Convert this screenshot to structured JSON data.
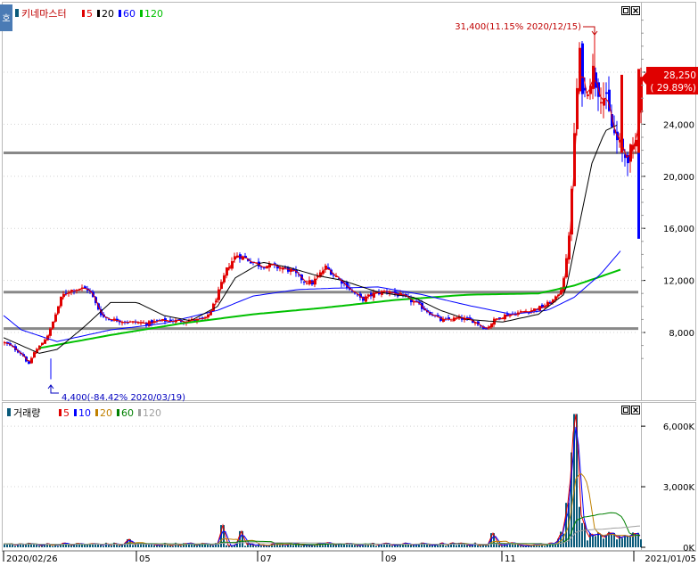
{
  "app": {
    "corner_label": "호",
    "window_buttons": [
      "□",
      "×"
    ]
  },
  "price_panel": {
    "stock_name": "키네마스터",
    "ma_legend": [
      {
        "label": "5",
        "color": "#e00000"
      },
      {
        "label": "20",
        "color": "#000000"
      },
      {
        "label": "60",
        "color": "#0000ff"
      },
      {
        "label": "120",
        "color": "#00c000"
      }
    ],
    "y_ticks": [
      "28,000",
      "24,000",
      "20,000",
      "16,000",
      "12,000",
      "8,000"
    ],
    "high_annotation": "31,400(11.15% 2020/12/15)",
    "low_annotation": "4,400(-84.42% 2020/03/19)",
    "current_price": "28,250",
    "current_change": "( 29.89%)"
  },
  "volume_panel": {
    "title": "거래량",
    "ma_legend": [
      {
        "label": "5",
        "color": "#e00000"
      },
      {
        "label": "10",
        "color": "#0000ff"
      },
      {
        "label": "20",
        "color": "#c08000"
      },
      {
        "label": "60",
        "color": "#008000"
      },
      {
        "label": "120",
        "color": "#a0a0a0"
      }
    ],
    "y_ticks": [
      "6,000K",
      "3,000K",
      "0K"
    ]
  },
  "x_axis": {
    "labels": [
      "2020/02/26",
      "05",
      "07",
      "09",
      "11",
      "2021/01/05"
    ]
  },
  "colors": {
    "up": "#e00000",
    "down": "#0000ff",
    "support_line": "#888888",
    "ma5": "#e00000",
    "ma20": "#000000",
    "ma60": "#0000ff",
    "ma120": "#00c000",
    "vol_bar": "#0a5a7a"
  },
  "chart_data": {
    "type": "candlestick",
    "y_range": [
      3000,
      33000
    ],
    "volume_range_k": [
      0,
      6800
    ],
    "horizontal_lines": [
      21800,
      11100,
      8300
    ],
    "close_anchors": [
      [
        0,
        7200
      ],
      [
        10,
        6800
      ],
      [
        20,
        6300
      ],
      [
        27,
        5500
      ],
      [
        32,
        6400
      ],
      [
        40,
        7000
      ],
      [
        50,
        8000
      ],
      [
        56,
        9200
      ],
      [
        64,
        10800
      ],
      [
        72,
        11200
      ],
      [
        84,
        11400
      ],
      [
        95,
        11300
      ],
      [
        102,
        10200
      ],
      [
        110,
        9200
      ],
      [
        120,
        9000
      ],
      [
        140,
        8800
      ],
      [
        160,
        8700
      ],
      [
        175,
        8900
      ],
      [
        200,
        8900
      ],
      [
        225,
        9000
      ],
      [
        235,
        10200
      ],
      [
        242,
        11500
      ],
      [
        250,
        13000
      ],
      [
        260,
        14000
      ],
      [
        270,
        13700
      ],
      [
        285,
        13200
      ],
      [
        300,
        13100
      ],
      [
        320,
        12800
      ],
      [
        335,
        12000
      ],
      [
        345,
        11800
      ],
      [
        360,
        13000
      ],
      [
        372,
        12300
      ],
      [
        385,
        11500
      ],
      [
        400,
        10500
      ],
      [
        415,
        11000
      ],
      [
        430,
        11200
      ],
      [
        445,
        10800
      ],
      [
        460,
        10300
      ],
      [
        475,
        9600
      ],
      [
        490,
        8900
      ],
      [
        510,
        9100
      ],
      [
        525,
        8900
      ],
      [
        540,
        8300
      ],
      [
        550,
        9000
      ],
      [
        560,
        9300
      ],
      [
        575,
        9500
      ],
      [
        590,
        9700
      ],
      [
        605,
        10000
      ],
      [
        618,
        10600
      ],
      [
        625,
        11500
      ],
      [
        630,
        13500
      ],
      [
        635,
        17000
      ],
      [
        640,
        25000
      ],
      [
        645,
        29000
      ],
      [
        650,
        26000
      ],
      [
        655,
        27500
      ],
      [
        660,
        28000
      ],
      [
        665,
        27000
      ],
      [
        670,
        26500
      ],
      [
        675,
        25500
      ],
      [
        680,
        24000
      ],
      [
        685,
        23000
      ],
      [
        690,
        22200
      ],
      [
        695,
        21500
      ],
      [
        700,
        21750
      ],
      [
        707,
        21750
      ],
      [
        714,
        28250
      ]
    ],
    "ma120_anchors": [
      [
        40,
        6800
      ],
      [
        120,
        7800
      ],
      [
        200,
        8700
      ],
      [
        280,
        9400
      ],
      [
        360,
        9900
      ],
      [
        440,
        10500
      ],
      [
        520,
        10900
      ],
      [
        600,
        11000
      ],
      [
        640,
        11600
      ],
      [
        670,
        12300
      ],
      [
        695,
        12900
      ]
    ],
    "ma60_anchors": [
      [
        0,
        9300
      ],
      [
        20,
        8200
      ],
      [
        60,
        7300
      ],
      [
        120,
        8200
      ],
      [
        180,
        8700
      ],
      [
        240,
        9700
      ],
      [
        280,
        10800
      ],
      [
        330,
        11300
      ],
      [
        370,
        11400
      ],
      [
        420,
        11500
      ],
      [
        470,
        10900
      ],
      [
        520,
        10100
      ],
      [
        570,
        9400
      ],
      [
        610,
        9700
      ],
      [
        640,
        10700
      ],
      [
        670,
        12500
      ],
      [
        695,
        14500
      ]
    ],
    "ma20_anchors": [
      [
        0,
        7600
      ],
      [
        20,
        7000
      ],
      [
        40,
        6400
      ],
      [
        60,
        6700
      ],
      [
        90,
        8400
      ],
      [
        120,
        10300
      ],
      [
        150,
        10300
      ],
      [
        180,
        9300
      ],
      [
        210,
        8900
      ],
      [
        240,
        10000
      ],
      [
        260,
        12200
      ],
      [
        290,
        13400
      ],
      [
        320,
        13000
      ],
      [
        350,
        12400
      ],
      [
        380,
        12000
      ],
      [
        420,
        11100
      ],
      [
        460,
        10700
      ],
      [
        490,
        9700
      ],
      [
        520,
        9000
      ],
      [
        560,
        8800
      ],
      [
        600,
        9400
      ],
      [
        630,
        11000
      ],
      [
        645,
        16000
      ],
      [
        660,
        21000
      ],
      [
        675,
        23500
      ],
      [
        690,
        24000
      ]
    ],
    "volume_spikes_k": [
      [
        140,
        400
      ],
      [
        245,
        1100
      ],
      [
        265,
        800
      ],
      [
        548,
        700
      ],
      [
        632,
        2200
      ],
      [
        638,
        4700
      ],
      [
        641,
        6600
      ],
      [
        645,
        2000
      ],
      [
        650,
        1200
      ]
    ]
  }
}
